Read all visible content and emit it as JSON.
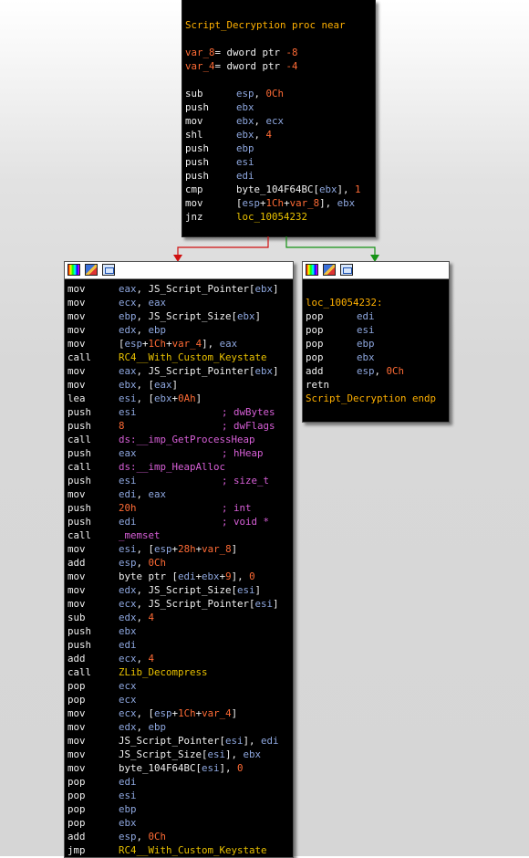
{
  "top_block": {
    "lines": [
      {
        "blank": true
      },
      {
        "label": "Script_Decryption proc near"
      },
      {
        "blank": true
      },
      {
        "var": "var_8",
        "decl": "= dword ptr ",
        "offset": "-8"
      },
      {
        "var": "var_4",
        "decl": "= dword ptr ",
        "offset": "-4"
      },
      {
        "blank": true
      },
      {
        "mnem": "sub",
        "ops": [
          {
            "t": "esp",
            "c": "b"
          },
          {
            "t": ", ",
            "c": "w"
          },
          {
            "t": "0Ch",
            "c": "o"
          }
        ]
      },
      {
        "mnem": "push",
        "ops": [
          {
            "t": "ebx",
            "c": "b"
          }
        ]
      },
      {
        "mnem": "mov",
        "ops": [
          {
            "t": "ebx",
            "c": "b"
          },
          {
            "t": ", ",
            "c": "w"
          },
          {
            "t": "ecx",
            "c": "b"
          }
        ]
      },
      {
        "mnem": "shl",
        "ops": [
          {
            "t": "ebx",
            "c": "b"
          },
          {
            "t": ", ",
            "c": "w"
          },
          {
            "t": "4",
            "c": "o"
          }
        ]
      },
      {
        "mnem": "push",
        "ops": [
          {
            "t": "ebp",
            "c": "b"
          }
        ]
      },
      {
        "mnem": "push",
        "ops": [
          {
            "t": "esi",
            "c": "b"
          }
        ]
      },
      {
        "mnem": "push",
        "ops": [
          {
            "t": "edi",
            "c": "b"
          }
        ]
      },
      {
        "mnem": "cmp",
        "ops": [
          {
            "t": "byte_104F64BC[",
            "c": "w"
          },
          {
            "t": "ebx",
            "c": "b"
          },
          {
            "t": "], ",
            "c": "w"
          },
          {
            "t": "1",
            "c": "o"
          }
        ]
      },
      {
        "mnem": "mov",
        "ops": [
          {
            "t": "[",
            "c": "w"
          },
          {
            "t": "esp",
            "c": "b"
          },
          {
            "t": "+",
            "c": "w"
          },
          {
            "t": "1Ch",
            "c": "o"
          },
          {
            "t": "+",
            "c": "w"
          },
          {
            "t": "var_8",
            "c": "o"
          },
          {
            "t": "], ",
            "c": "w"
          },
          {
            "t": "ebx",
            "c": "b"
          }
        ]
      },
      {
        "mnem": "jnz",
        "ops": [
          {
            "t": "loc_10054232",
            "c": "y"
          }
        ]
      }
    ]
  },
  "left_block": {
    "lines": [
      {
        "mnem": "mov",
        "ops": [
          {
            "t": "eax",
            "c": "b"
          },
          {
            "t": ", JS_Script_Pointer[",
            "c": "w"
          },
          {
            "t": "ebx",
            "c": "b"
          },
          {
            "t": "]",
            "c": "w"
          }
        ]
      },
      {
        "mnem": "mov",
        "ops": [
          {
            "t": "ecx",
            "c": "b"
          },
          {
            "t": ", ",
            "c": "w"
          },
          {
            "t": "eax",
            "c": "b"
          }
        ]
      },
      {
        "mnem": "mov",
        "ops": [
          {
            "t": "ebp",
            "c": "b"
          },
          {
            "t": ", JS_Script_Size[",
            "c": "w"
          },
          {
            "t": "ebx",
            "c": "b"
          },
          {
            "t": "]",
            "c": "w"
          }
        ]
      },
      {
        "mnem": "mov",
        "ops": [
          {
            "t": "edx",
            "c": "b"
          },
          {
            "t": ", ",
            "c": "w"
          },
          {
            "t": "ebp",
            "c": "b"
          }
        ]
      },
      {
        "mnem": "mov",
        "ops": [
          {
            "t": "[",
            "c": "w"
          },
          {
            "t": "esp",
            "c": "b"
          },
          {
            "t": "+",
            "c": "w"
          },
          {
            "t": "1Ch",
            "c": "o"
          },
          {
            "t": "+",
            "c": "w"
          },
          {
            "t": "var_4",
            "c": "o"
          },
          {
            "t": "], ",
            "c": "w"
          },
          {
            "t": "eax",
            "c": "b"
          }
        ]
      },
      {
        "mnem": "call",
        "ops": [
          {
            "t": "RC4__With_Custom_Keystate",
            "c": "y"
          }
        ]
      },
      {
        "mnem": "mov",
        "ops": [
          {
            "t": "eax",
            "c": "b"
          },
          {
            "t": ", JS_Script_Pointer[",
            "c": "w"
          },
          {
            "t": "ebx",
            "c": "b"
          },
          {
            "t": "]",
            "c": "w"
          }
        ]
      },
      {
        "mnem": "mov",
        "ops": [
          {
            "t": "ebx",
            "c": "b"
          },
          {
            "t": ", [",
            "c": "w"
          },
          {
            "t": "eax",
            "c": "b"
          },
          {
            "t": "]",
            "c": "w"
          }
        ]
      },
      {
        "mnem": "lea",
        "ops": [
          {
            "t": "esi",
            "c": "b"
          },
          {
            "t": ", [",
            "c": "w"
          },
          {
            "t": "ebx",
            "c": "b"
          },
          {
            "t": "+",
            "c": "w"
          },
          {
            "t": "0Ah",
            "c": "o"
          },
          {
            "t": "]",
            "c": "w"
          }
        ]
      },
      {
        "mnem": "push",
        "ops": [
          {
            "t": "esi",
            "c": "b"
          }
        ],
        "comment": "; dwBytes"
      },
      {
        "mnem": "push",
        "ops": [
          {
            "t": "8",
            "c": "o"
          }
        ],
        "comment": "; dwFlags"
      },
      {
        "mnem": "call",
        "ops": [
          {
            "t": "ds:__imp_GetProcessHeap",
            "c": "m"
          }
        ]
      },
      {
        "mnem": "push",
        "ops": [
          {
            "t": "eax",
            "c": "b"
          }
        ],
        "comment": "; hHeap"
      },
      {
        "mnem": "call",
        "ops": [
          {
            "t": "ds:__imp_HeapAlloc",
            "c": "m"
          }
        ]
      },
      {
        "mnem": "push",
        "ops": [
          {
            "t": "esi",
            "c": "b"
          }
        ],
        "comment": "; size_t"
      },
      {
        "mnem": "mov",
        "ops": [
          {
            "t": "edi",
            "c": "b"
          },
          {
            "t": ", ",
            "c": "w"
          },
          {
            "t": "eax",
            "c": "b"
          }
        ]
      },
      {
        "mnem": "push",
        "ops": [
          {
            "t": "20h",
            "c": "o"
          }
        ],
        "comment": "; int"
      },
      {
        "mnem": "push",
        "ops": [
          {
            "t": "edi",
            "c": "b"
          }
        ],
        "comment": "; void *"
      },
      {
        "mnem": "call",
        "ops": [
          {
            "t": "_memset",
            "c": "m"
          }
        ]
      },
      {
        "mnem": "mov",
        "ops": [
          {
            "t": "esi",
            "c": "b"
          },
          {
            "t": ", [",
            "c": "w"
          },
          {
            "t": "esp",
            "c": "b"
          },
          {
            "t": "+",
            "c": "w"
          },
          {
            "t": "28h",
            "c": "o"
          },
          {
            "t": "+",
            "c": "w"
          },
          {
            "t": "var_8",
            "c": "o"
          },
          {
            "t": "]",
            "c": "w"
          }
        ]
      },
      {
        "mnem": "add",
        "ops": [
          {
            "t": "esp",
            "c": "b"
          },
          {
            "t": ", ",
            "c": "w"
          },
          {
            "t": "0Ch",
            "c": "o"
          }
        ]
      },
      {
        "mnem": "mov",
        "ops": [
          {
            "t": "byte ptr [",
            "c": "w"
          },
          {
            "t": "edi",
            "c": "b"
          },
          {
            "t": "+",
            "c": "w"
          },
          {
            "t": "ebx",
            "c": "b"
          },
          {
            "t": "+",
            "c": "w"
          },
          {
            "t": "9",
            "c": "o"
          },
          {
            "t": "], ",
            "c": "w"
          },
          {
            "t": "0",
            "c": "o"
          }
        ]
      },
      {
        "mnem": "mov",
        "ops": [
          {
            "t": "edx",
            "c": "b"
          },
          {
            "t": ", JS_Script_Size[",
            "c": "w"
          },
          {
            "t": "esi",
            "c": "b"
          },
          {
            "t": "]",
            "c": "w"
          }
        ]
      },
      {
        "mnem": "mov",
        "ops": [
          {
            "t": "ecx",
            "c": "b"
          },
          {
            "t": ", JS_Script_Pointer[",
            "c": "w"
          },
          {
            "t": "esi",
            "c": "b"
          },
          {
            "t": "]",
            "c": "w"
          }
        ]
      },
      {
        "mnem": "sub",
        "ops": [
          {
            "t": "edx",
            "c": "b"
          },
          {
            "t": ", ",
            "c": "w"
          },
          {
            "t": "4",
            "c": "o"
          }
        ]
      },
      {
        "mnem": "push",
        "ops": [
          {
            "t": "ebx",
            "c": "b"
          }
        ]
      },
      {
        "mnem": "push",
        "ops": [
          {
            "t": "edi",
            "c": "b"
          }
        ]
      },
      {
        "mnem": "add",
        "ops": [
          {
            "t": "ecx",
            "c": "b"
          },
          {
            "t": ", ",
            "c": "w"
          },
          {
            "t": "4",
            "c": "o"
          }
        ]
      },
      {
        "mnem": "call",
        "ops": [
          {
            "t": "ZLib_Decompress",
            "c": "y"
          }
        ]
      },
      {
        "mnem": "pop",
        "ops": [
          {
            "t": "ecx",
            "c": "b"
          }
        ]
      },
      {
        "mnem": "pop",
        "ops": [
          {
            "t": "ecx",
            "c": "b"
          }
        ]
      },
      {
        "mnem": "mov",
        "ops": [
          {
            "t": "ecx",
            "c": "b"
          },
          {
            "t": ", [",
            "c": "w"
          },
          {
            "t": "esp",
            "c": "b"
          },
          {
            "t": "+",
            "c": "w"
          },
          {
            "t": "1Ch",
            "c": "o"
          },
          {
            "t": "+",
            "c": "w"
          },
          {
            "t": "var_4",
            "c": "o"
          },
          {
            "t": "]",
            "c": "w"
          }
        ]
      },
      {
        "mnem": "mov",
        "ops": [
          {
            "t": "edx",
            "c": "b"
          },
          {
            "t": ", ",
            "c": "w"
          },
          {
            "t": "ebp",
            "c": "b"
          }
        ]
      },
      {
        "mnem": "mov",
        "ops": [
          {
            "t": "JS_Script_Pointer[",
            "c": "w"
          },
          {
            "t": "esi",
            "c": "b"
          },
          {
            "t": "], ",
            "c": "w"
          },
          {
            "t": "edi",
            "c": "b"
          }
        ]
      },
      {
        "mnem": "mov",
        "ops": [
          {
            "t": "JS_Script_Size[",
            "c": "w"
          },
          {
            "t": "esi",
            "c": "b"
          },
          {
            "t": "], ",
            "c": "w"
          },
          {
            "t": "ebx",
            "c": "b"
          }
        ]
      },
      {
        "mnem": "mov",
        "ops": [
          {
            "t": "byte_104F64BC[",
            "c": "w"
          },
          {
            "t": "esi",
            "c": "b"
          },
          {
            "t": "], ",
            "c": "w"
          },
          {
            "t": "0",
            "c": "o"
          }
        ]
      },
      {
        "mnem": "pop",
        "ops": [
          {
            "t": "edi",
            "c": "b"
          }
        ]
      },
      {
        "mnem": "pop",
        "ops": [
          {
            "t": "esi",
            "c": "b"
          }
        ]
      },
      {
        "mnem": "pop",
        "ops": [
          {
            "t": "ebp",
            "c": "b"
          }
        ]
      },
      {
        "mnem": "pop",
        "ops": [
          {
            "t": "ebx",
            "c": "b"
          }
        ]
      },
      {
        "mnem": "add",
        "ops": [
          {
            "t": "esp",
            "c": "b"
          },
          {
            "t": ", ",
            "c": "w"
          },
          {
            "t": "0Ch",
            "c": "o"
          }
        ]
      },
      {
        "mnem": "jmp",
        "ops": [
          {
            "t": "RC4__With_Custom_Keystate",
            "c": "y"
          }
        ]
      }
    ]
  },
  "right_block": {
    "lines": [
      {
        "blank": true
      },
      {
        "label": "loc_10054232:"
      },
      {
        "mnem": "pop",
        "ops": [
          {
            "t": "edi",
            "c": "b"
          }
        ]
      },
      {
        "mnem": "pop",
        "ops": [
          {
            "t": "esi",
            "c": "b"
          }
        ]
      },
      {
        "mnem": "pop",
        "ops": [
          {
            "t": "ebp",
            "c": "b"
          }
        ]
      },
      {
        "mnem": "pop",
        "ops": [
          {
            "t": "ebx",
            "c": "b"
          }
        ]
      },
      {
        "mnem": "add",
        "ops": [
          {
            "t": "esp",
            "c": "b"
          },
          {
            "t": ", ",
            "c": "w"
          },
          {
            "t": "0Ch",
            "c": "o"
          }
        ]
      },
      {
        "mnem": "retn",
        "ops": []
      },
      {
        "label": "Script_Decryption endp"
      }
    ]
  },
  "toolbar_icons": [
    "color-palette-icon",
    "edit-pencil-icon",
    "graph-view-icon"
  ],
  "edge_colors": {
    "false_branch": "#d01010",
    "true_branch": "#149214"
  }
}
